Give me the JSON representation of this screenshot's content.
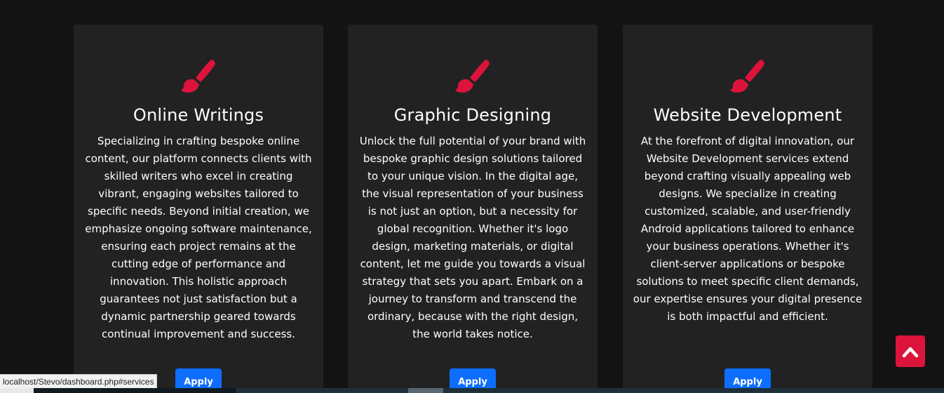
{
  "cards": [
    {
      "icon": "paintbrush-icon",
      "title": "Online Writings",
      "body": "Specializing in crafting bespoke online content, our platform connects clients with skilled writers who excel in creating vibrant, engaging websites tailored to specific needs. Beyond initial creation, we emphasize ongoing software maintenance, ensuring each project remains at the cutting edge of performance and innovation. This holistic approach guarantees not just satisfaction but a dynamic partnership geared towards continual improvement and success.",
      "button_label": "Apply"
    },
    {
      "icon": "paintbrush-icon",
      "title": "Graphic Designing",
      "body": "Unlock the full potential of your brand with bespoke graphic design solutions tailored to your unique vision. In the digital age, the visual representation of your business is not just an option, but a necessity for global recognition. Whether it's logo design, marketing materials, or digital content, let me guide you towards a visual strategy that sets you apart. Embark on a journey to transform and transcend the ordinary, because with the right design, the world takes notice.",
      "button_label": "Apply"
    },
    {
      "icon": "paintbrush-icon",
      "title": "Website Development",
      "body": "At the forefront of digital innovation, our Website Development services extend beyond crafting visually appealing web designs. We specialize in creating customized, scalable, and user-friendly Android applications tailored to enhance your business operations. Whether it's client-server applications or bespoke solutions to meet specific client demands, our expertise ensures your digital presence is both impactful and efficient.",
      "button_label": "Apply"
    }
  ],
  "scroll_top": {
    "icon": "chevron-up-icon"
  },
  "status_bar": {
    "url": "localhost/Stevo/dashboard.php#services"
  },
  "colors": {
    "background": "#131313",
    "card": "#222222",
    "accent": "#dc143c",
    "button": "#0d6efd",
    "text": "#ffffff"
  }
}
